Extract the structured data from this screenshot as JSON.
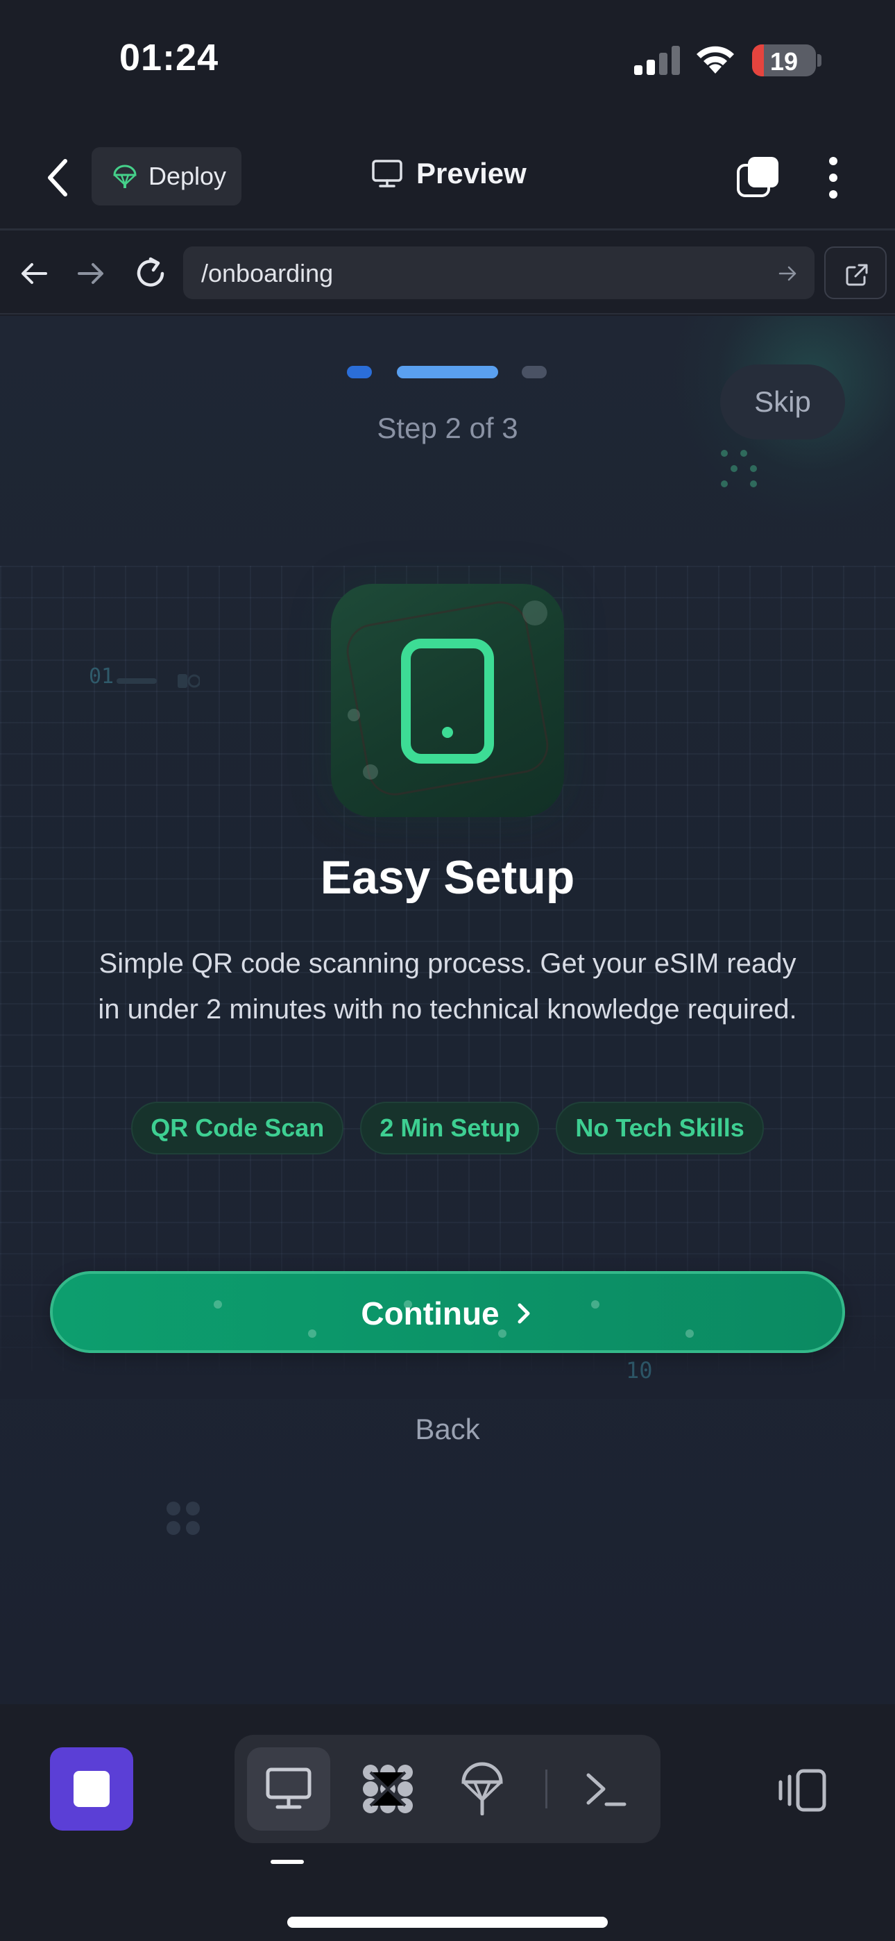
{
  "status_bar": {
    "time": "01:24",
    "battery": "19",
    "battery_level": 0.19,
    "battery_color": "#e5443e"
  },
  "header": {
    "back_icon": "chevron-left-icon",
    "deploy_label": "Deploy",
    "deploy_icon": "parachute-icon",
    "title": "Preview",
    "title_icon": "monitor-icon",
    "tabs_icon": "tabs-icon",
    "more_icon": "more-vertical-icon"
  },
  "browser": {
    "url": "/onboarding",
    "back_icon": "arrow-left-icon",
    "forward_icon": "arrow-right-icon",
    "reload_icon": "reload-icon",
    "go_icon": "arrow-right-icon",
    "external_icon": "external-link-icon"
  },
  "onboarding": {
    "progress": {
      "current": 2,
      "total": 3
    },
    "step_label": "Step 2 of 3",
    "skip_label": "Skip",
    "feature_icon": "smartphone-icon",
    "heading": "Easy Setup",
    "description": "Simple QR code scanning process. Get your eSIM ready in under 2 minutes with no technical knowledge required.",
    "chips": [
      "QR Code Scan",
      "2 Min Setup",
      "No Tech Skills"
    ],
    "decor_code_1": "01",
    "decor_code_2": "10",
    "continue_label": "Continue",
    "back_label": "Back",
    "accent_color": "#0d9e6e",
    "progress_color": "#5aa0f0"
  },
  "toolbar": {
    "stop_icon": "stop-icon",
    "items": [
      "monitor-icon",
      "components-icon",
      "deploy-icon",
      "terminal-icon"
    ],
    "active_item": "monitor-icon",
    "device_toggle_icon": "device-toggle-icon",
    "stop_color": "#5b3fd6"
  }
}
